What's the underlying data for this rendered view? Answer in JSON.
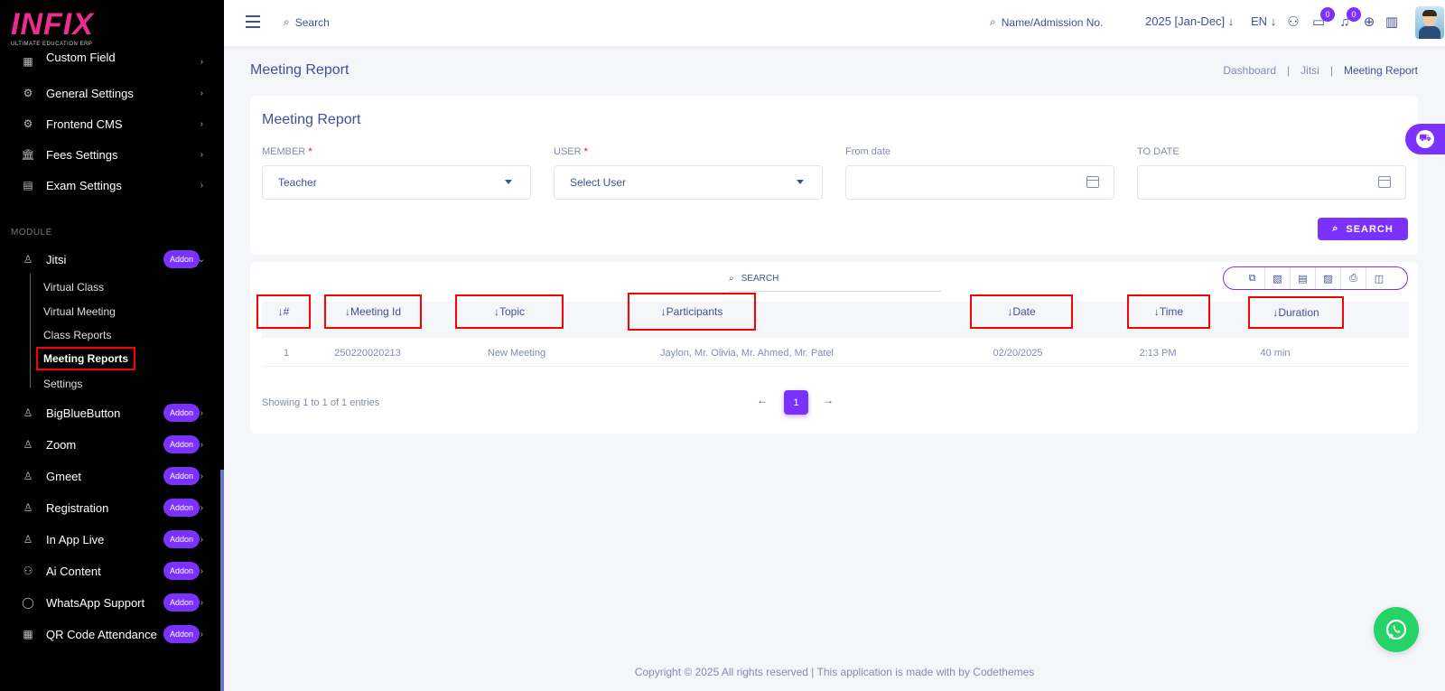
{
  "brand": {
    "logo": "INFIX",
    "tagline": "ULTIMATE EDUCATION ERP"
  },
  "sidebar": {
    "items_top": [
      {
        "label": "Custom Field",
        "icon": "grid-icon"
      },
      {
        "label": "General Settings",
        "icon": "gears-icon"
      },
      {
        "label": "Frontend CMS",
        "icon": "gears-icon"
      },
      {
        "label": "Fees Settings",
        "icon": "bank-icon"
      },
      {
        "label": "Exam Settings",
        "icon": "book-icon"
      }
    ],
    "module_label": "MODULE",
    "jitsi": {
      "label": "Jitsi",
      "badge": "Addon"
    },
    "jitsi_sub": [
      {
        "label": "Virtual Class"
      },
      {
        "label": "Virtual Meeting"
      },
      {
        "label": "Class Reports"
      },
      {
        "label": "Meeting Reports"
      },
      {
        "label": "Settings"
      }
    ],
    "addons": [
      {
        "label": "BigBlueButton",
        "badge": "Addon"
      },
      {
        "label": "Zoom",
        "badge": "Addon"
      },
      {
        "label": "Gmeet",
        "badge": "Addon"
      },
      {
        "label": "Registration",
        "badge": "Addon"
      },
      {
        "label": "In App Live",
        "badge": "Addon"
      },
      {
        "label": "Ai Content",
        "badge": "Addon"
      },
      {
        "label": "WhatsApp Support",
        "badge": "Addon"
      },
      {
        "label": "QR Code Attendance",
        "badge": "Addon"
      }
    ]
  },
  "header": {
    "search_label": "Search",
    "name_search_label": "Name/Admission No.",
    "year": "2025 [Jan-Dec]",
    "lang": "EN",
    "message_count": "0",
    "notification_count": "0"
  },
  "page": {
    "title": "Meeting Report",
    "breadcrumb": [
      "Dashboard",
      "Jitsi",
      "Meeting Report"
    ]
  },
  "filter": {
    "title": "Meeting Report",
    "member_label": "MEMBER",
    "member_value": "Teacher",
    "user_label": "USER",
    "user_value": "Select User",
    "from_label": "From date",
    "to_label": "TO DATE",
    "required_mark": "*",
    "search_button": "SEARCH"
  },
  "table": {
    "search_placeholder": "SEARCH",
    "columns": [
      "#",
      "Meeting Id",
      "Topic",
      "Participants",
      "Date",
      "Time",
      "Duration"
    ],
    "rows": [
      [
        "1",
        "250220020213",
        "New Meeting",
        "Jaylon, Mr. Olivia, Mr. Ahmed, Mr. Patel",
        "02/20/2025",
        "2:13 PM",
        "40 min"
      ]
    ],
    "entries_text": "Showing 1 to 1 of 1 entries",
    "current_page": "1"
  },
  "footer": {
    "text": "Copyright © 2025 All rights reserved | This application is made with by Codethemes"
  },
  "colors": {
    "accent": "#7c32ff",
    "text": "#415094",
    "muted": "#828bb2",
    "highlight": "#ff0000",
    "whatsapp": "#25d366"
  }
}
